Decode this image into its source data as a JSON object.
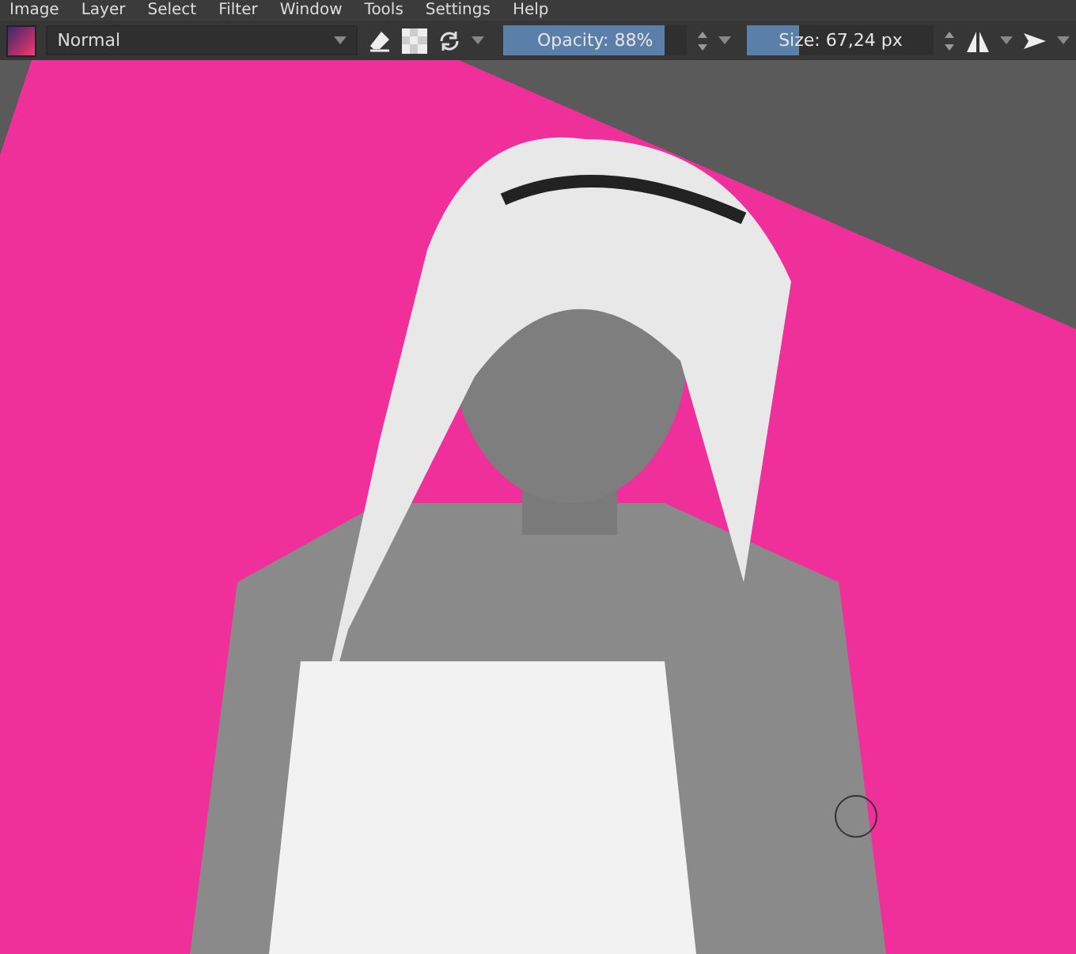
{
  "menu": [
    "Image",
    "Layer",
    "Select",
    "Filter",
    "Window",
    "Tools",
    "Settings",
    "Help"
  ],
  "toolbar": {
    "blend_mode": "Normal",
    "opacity": {
      "label": "Opacity: 88%",
      "level": 0.88
    },
    "size": {
      "label": "Size: 67,24 px",
      "level": 0.28
    }
  }
}
